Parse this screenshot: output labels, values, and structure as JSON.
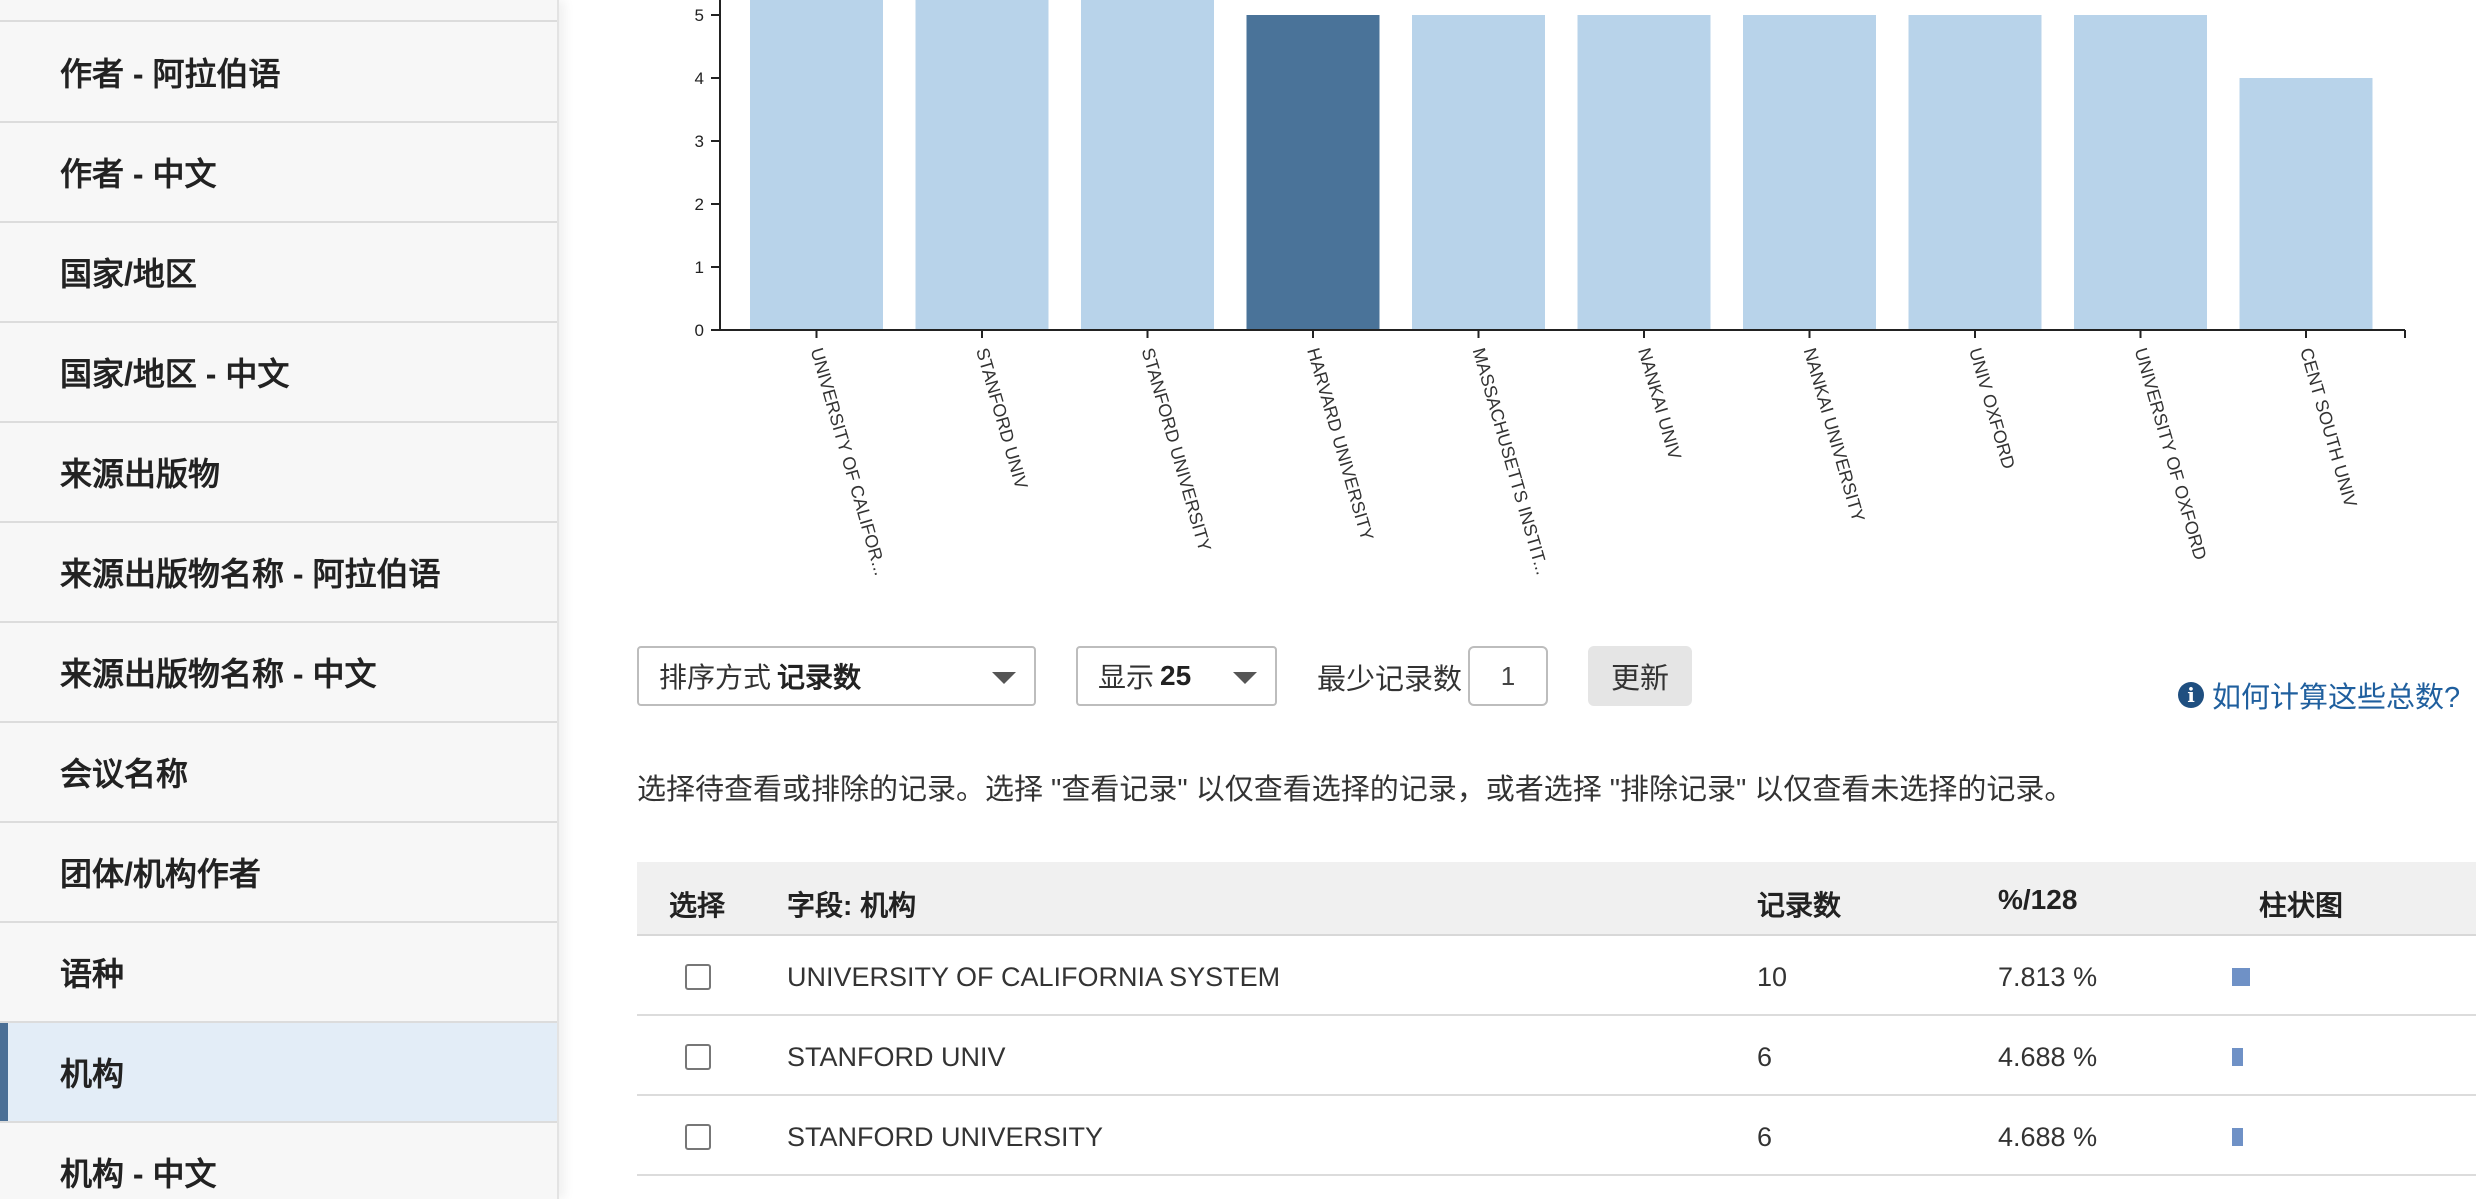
{
  "sidebar": {
    "items": [
      {
        "label": "作者 - 阿拉伯语",
        "active": false
      },
      {
        "label": "作者 - 中文",
        "active": false
      },
      {
        "label": "国家/地区",
        "active": false
      },
      {
        "label": "国家/地区 - 中文",
        "active": false
      },
      {
        "label": "来源出版物",
        "active": false
      },
      {
        "label": "来源出版物名称 - 阿拉伯语",
        "active": false
      },
      {
        "label": "来源出版物名称 - 中文",
        "active": false
      },
      {
        "label": "会议名称",
        "active": false
      },
      {
        "label": "团体/机构作者",
        "active": false
      },
      {
        "label": "语种",
        "active": false
      },
      {
        "label": "机构",
        "active": true
      },
      {
        "label": "机构 - 中文",
        "active": false
      }
    ]
  },
  "chart_data": {
    "type": "bar",
    "categories": [
      "UNIVERSITY OF CALIFOR...",
      "STANFORD UNIV",
      "STANFORD UNIVERSITY",
      "HARVARD UNIVERSITY",
      "MASSACHUSETTS INSTIT...",
      "NANKAI UNIV",
      "NANKAI UNIVERSITY",
      "UNIV OXFORD",
      "UNIVERSITY OF OXFORD",
      "CENT SOUTH UNIV"
    ],
    "values": [
      10,
      6,
      6,
      5,
      5,
      5,
      5,
      5,
      5,
      4
    ],
    "highlight_index": 3,
    "yticks": [
      0,
      1,
      2,
      3,
      4,
      5
    ],
    "colors": {
      "bar": "#b8d3ea",
      "highlight": "#4a7399",
      "axis": "#222222"
    }
  },
  "controls": {
    "sort_prefix": "排序方式",
    "sort_value": "记录数",
    "show_prefix": "显示",
    "show_value": "25",
    "min_records_label": "最少记录数",
    "min_records_value": "1",
    "update_label": "更新",
    "help_text": "如何计算这些总数?"
  },
  "instructions": "选择待查看或排除的记录。选择 \"查看记录\" 以仅查看选择的记录，或者选择 \"排除记录\" 以仅查看未选择的记录。",
  "table": {
    "headers": {
      "select": "选择",
      "field": "字段: 机构",
      "count": "记录数",
      "percent": "%/128",
      "bar": "柱状图"
    },
    "rows": [
      {
        "name": "UNIVERSITY OF CALIFORNIA SYSTEM",
        "count": "10",
        "percent": "7.813 %",
        "bar_value": 10
      },
      {
        "name": "STANFORD UNIV",
        "count": "6",
        "percent": "4.688 %",
        "bar_value": 6
      },
      {
        "name": "STANFORD UNIVERSITY",
        "count": "6",
        "percent": "4.688 %",
        "bar_value": 6
      }
    ]
  }
}
